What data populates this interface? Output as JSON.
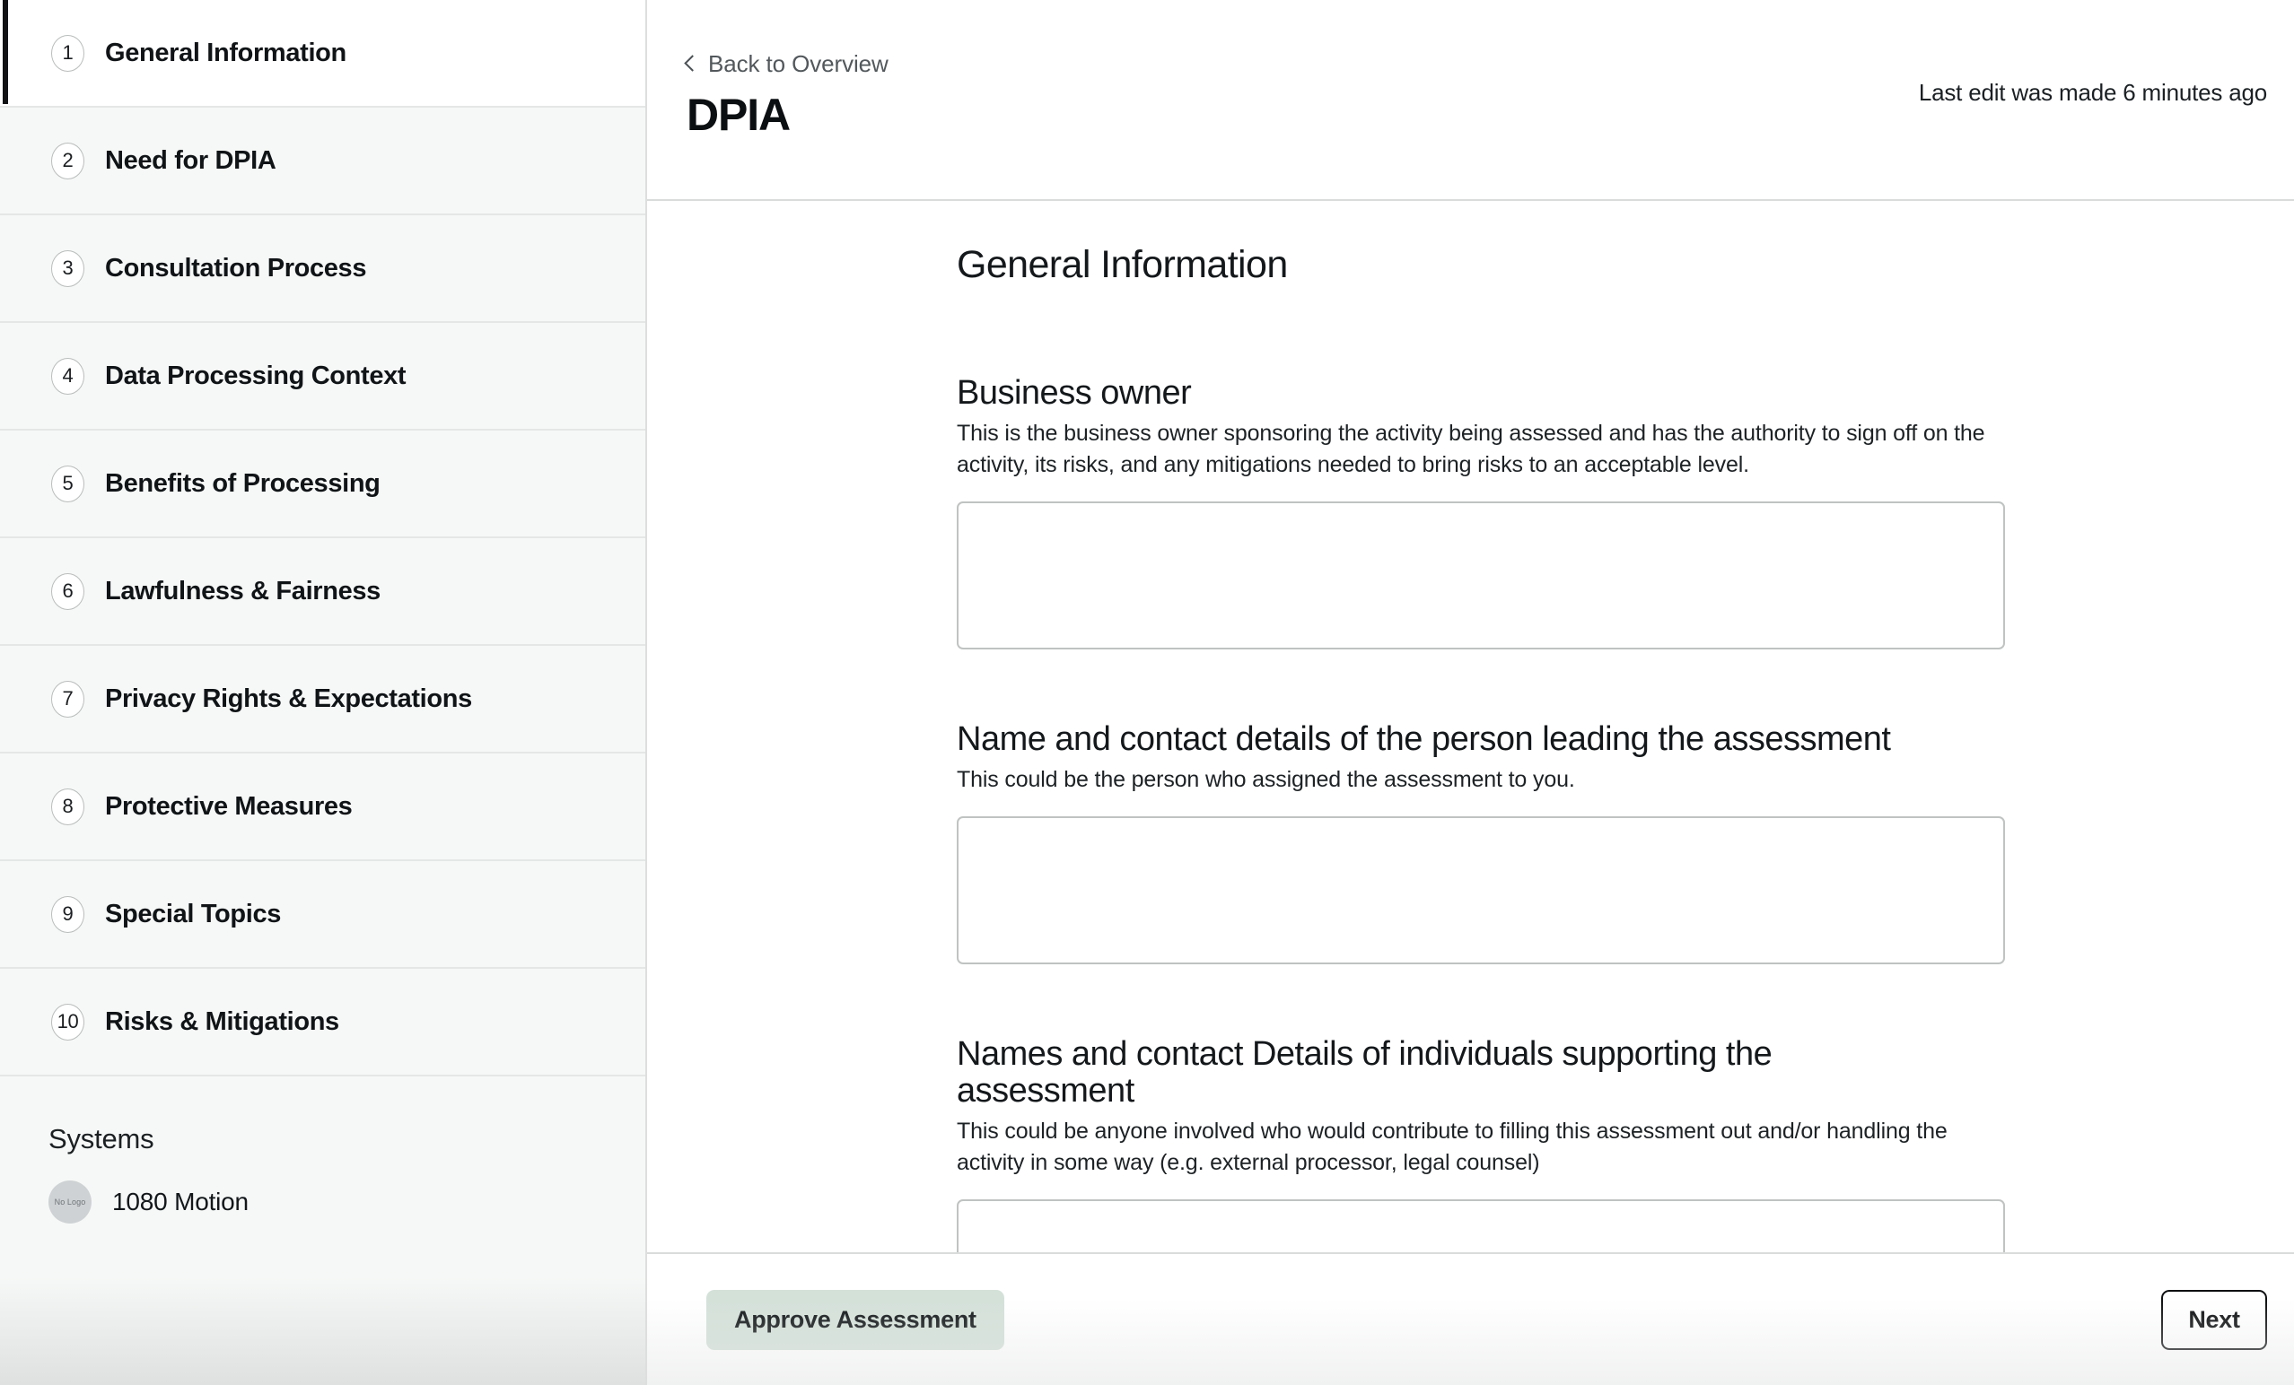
{
  "sidebar": {
    "items": [
      {
        "number": "1",
        "label": "General Information",
        "active": true
      },
      {
        "number": "2",
        "label": "Need for DPIA",
        "active": false
      },
      {
        "number": "3",
        "label": "Consultation Process",
        "active": false
      },
      {
        "number": "4",
        "label": "Data Processing Context",
        "active": false
      },
      {
        "number": "5",
        "label": "Benefits of Processing",
        "active": false
      },
      {
        "number": "6",
        "label": "Lawfulness & Fairness",
        "active": false
      },
      {
        "number": "7",
        "label": "Privacy Rights & Expectations",
        "active": false
      },
      {
        "number": "8",
        "label": "Protective Measures",
        "active": false
      },
      {
        "number": "9",
        "label": "Special Topics",
        "active": false
      },
      {
        "number": "10",
        "label": "Risks & Mitigations",
        "active": false
      }
    ],
    "systems": {
      "title": "Systems",
      "entries": [
        {
          "name": "1080 Motion",
          "logo_placeholder": "No Logo"
        }
      ]
    }
  },
  "header": {
    "back_label": "Back to Overview",
    "back_icon": "chevron-left-icon",
    "title": "DPIA",
    "last_edit": "Last edit was made 6 minutes ago"
  },
  "main": {
    "section_title": "General Information",
    "fields": [
      {
        "label": "Business owner",
        "help": "This is the business owner sponsoring the activity being assessed and has the authority to sign off on the activity, its risks, and any mitigations needed to bring risks to an acceptable level.",
        "value": "",
        "placeholder": ""
      },
      {
        "label": "Name and contact details of the person leading the assessment",
        "help": "This could be the person who assigned the assessment to you.",
        "value": "",
        "placeholder": ""
      },
      {
        "label": "Names and contact Details of individuals supporting the assessment",
        "help": "This could be anyone involved who would contribute to filling this assessment out and/or handling the activity in some way (e.g. external processor, legal counsel)",
        "value": "",
        "placeholder": ""
      }
    ]
  },
  "footer": {
    "approve_label": "Approve Assessment",
    "next_label": "Next"
  },
  "colors": {
    "accent_approve_bg": "#d4e1d9",
    "sidebar_bg": "#f6f8f7",
    "active_indicator": "#111315",
    "border": "#d9dcdb",
    "text": "#14181b"
  }
}
